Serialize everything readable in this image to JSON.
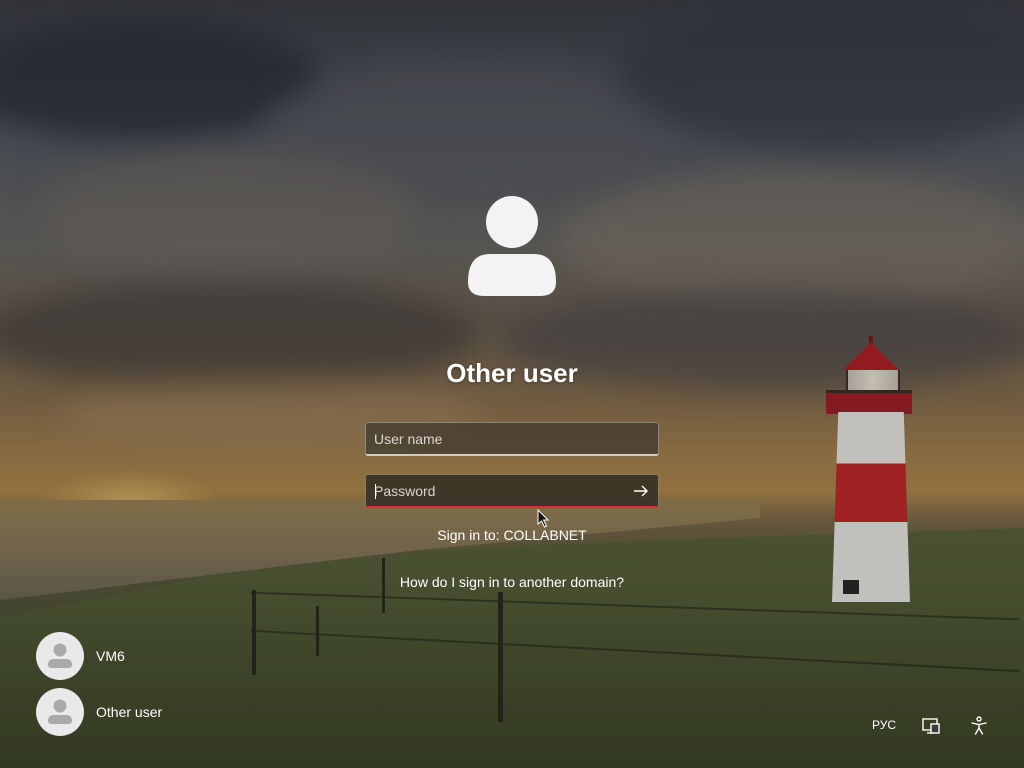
{
  "login": {
    "title": "Other user",
    "username_placeholder": "User name",
    "password_placeholder": "Password",
    "sign_in_to": "Sign in to: COLLABNET",
    "other_domain_link": "How do I sign in to another domain?"
  },
  "users": [
    {
      "name": "VM6"
    },
    {
      "name": "Other user"
    }
  ],
  "tray": {
    "language": "РУС"
  },
  "icons": {
    "avatar": "user-silhouette-icon",
    "submit": "arrow-right-icon",
    "network": "network-icon",
    "accessibility": "accessibility-icon"
  },
  "colors": {
    "password_underline": "#d83030",
    "lighthouse_red": "#c42a2a"
  }
}
